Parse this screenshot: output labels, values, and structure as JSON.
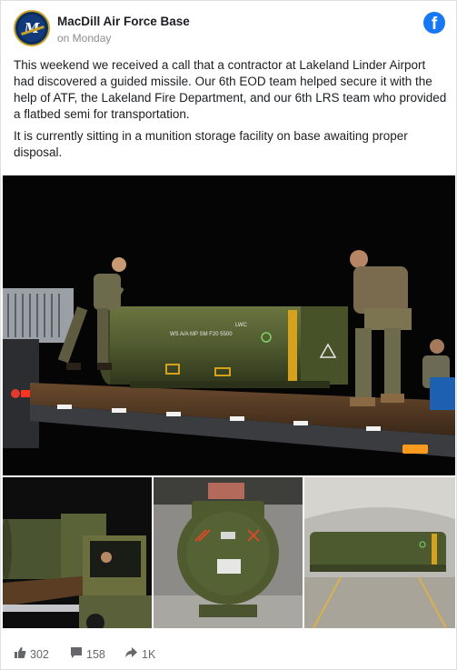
{
  "post": {
    "page_name": "MacDill Air Force Base",
    "avatar_text": "M",
    "time": "on Monday",
    "facebook_logo": "f",
    "paragraphs": [
      "This weekend we received a call that a contractor at Lakeland Linder Airport had discovered a guided missile. Our 6th EOD team helped secure it with the help of ATF, the Lakeland Fire Department, and our 6th LRS team who provided a flatbed semi for transportation.",
      "It is currently sitting in a munition storage facility on base awaiting proper disposal."
    ]
  },
  "photos": {
    "main_marking_1": "WS A/A MP SM F20 5500",
    "main_marking_2": "LWC",
    "thumb_count": 3
  },
  "footer": {
    "likes": "302",
    "comments": "158",
    "shares": "1K",
    "icons": [
      "thumbs-up-icon",
      "comment-icon",
      "share-icon"
    ]
  },
  "colors": {
    "facebook_blue": "#1877f2",
    "missile_green": "#4f5a2f",
    "text_primary": "#1c1e21",
    "text_secondary": "#65676b"
  }
}
